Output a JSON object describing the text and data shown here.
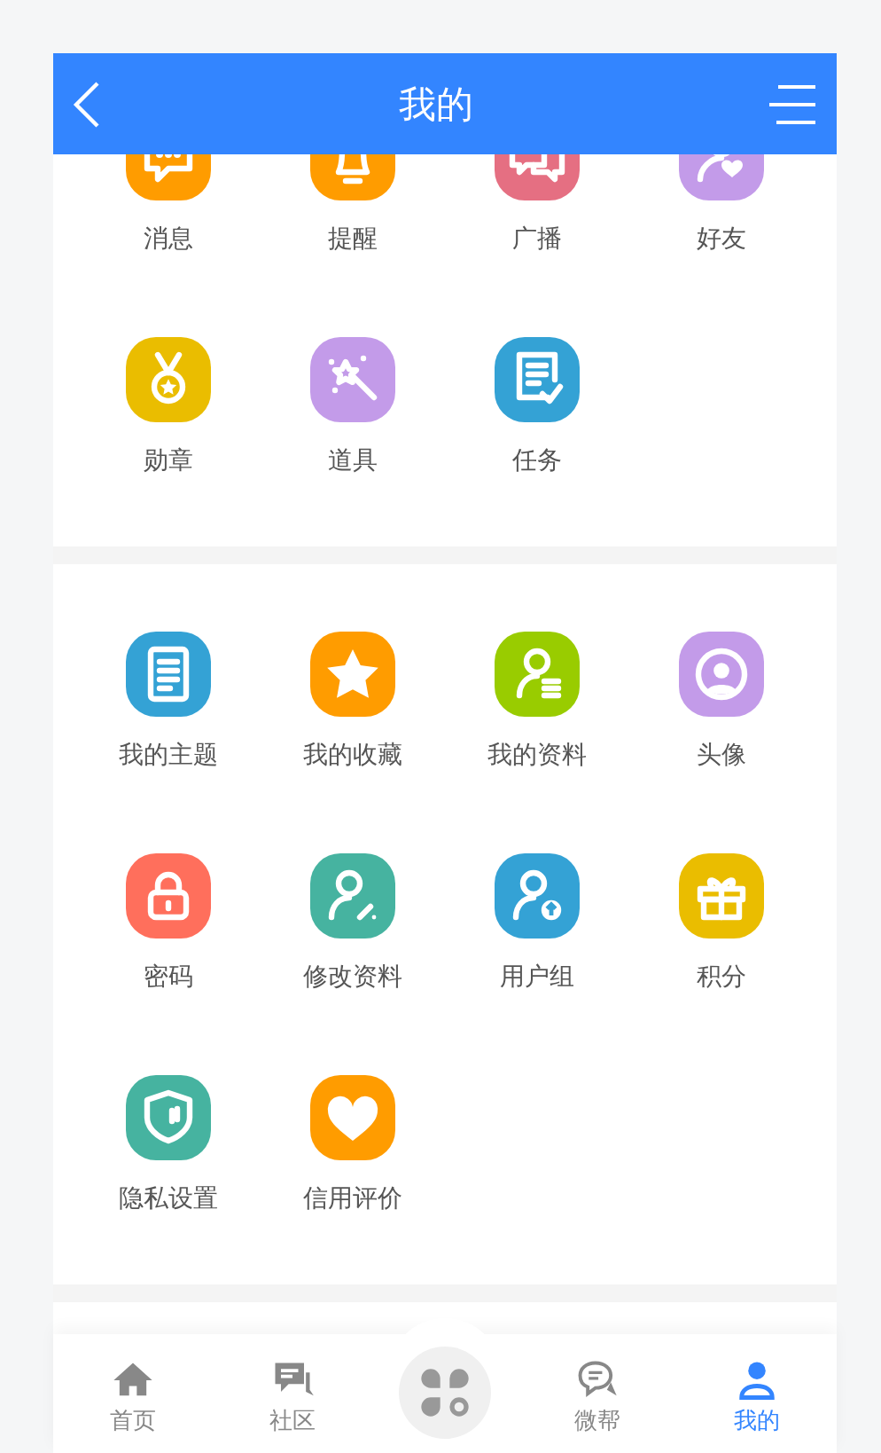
{
  "header": {
    "title": "我的"
  },
  "sections": [
    {
      "items": [
        {
          "label": "消息",
          "color": "#ff9c00"
        },
        {
          "label": "提醒",
          "color": "#ff9c00"
        },
        {
          "label": "广播",
          "color": "#e56f82"
        },
        {
          "label": "好友",
          "color": "#c39be9"
        },
        {
          "label": "勋章",
          "color": "#eabd00"
        },
        {
          "label": "道具",
          "color": "#c39be9"
        },
        {
          "label": "任务",
          "color": "#34a2d5"
        }
      ]
    },
    {
      "items": [
        {
          "label": "我的主题",
          "color": "#34a2d5"
        },
        {
          "label": "我的收藏",
          "color": "#ff9c00"
        },
        {
          "label": "我的资料",
          "color": "#99cc00"
        },
        {
          "label": "头像",
          "color": "#c39be9"
        },
        {
          "label": "密码",
          "color": "#ff6f5c"
        },
        {
          "label": "修改资料",
          "color": "#46b3a0"
        },
        {
          "label": "用户组",
          "color": "#34a2d5"
        },
        {
          "label": "积分",
          "color": "#eabd00"
        },
        {
          "label": "隐私设置",
          "color": "#46b3a0"
        },
        {
          "label": "信用评价",
          "color": "#ff9c00"
        }
      ]
    }
  ],
  "nav": [
    {
      "label": "首页",
      "selected": false
    },
    {
      "label": "社区",
      "selected": false
    },
    {
      "kind": "center"
    },
    {
      "label": "微帮",
      "selected": false
    },
    {
      "label": "我的",
      "selected": true
    }
  ]
}
